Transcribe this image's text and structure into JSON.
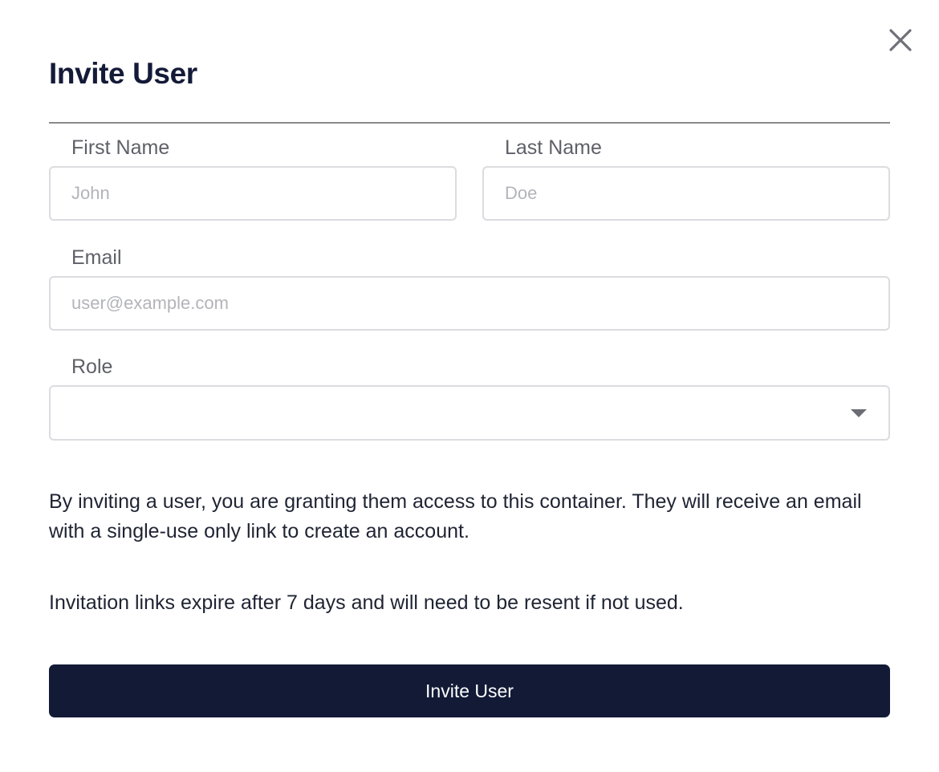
{
  "dialog": {
    "title": "Invite User",
    "close_icon": "close-icon"
  },
  "form": {
    "first_name": {
      "label": "First Name",
      "placeholder": "John",
      "value": ""
    },
    "last_name": {
      "label": "Last Name",
      "placeholder": "Doe",
      "value": ""
    },
    "email": {
      "label": "Email",
      "placeholder": "user@example.com",
      "value": ""
    },
    "role": {
      "label": "Role",
      "selected": "",
      "icon": "chevron-down-icon"
    }
  },
  "notices": [
    "By inviting a user, you are granting them access to this container. They will receive an email with a single-use only link to create an account.",
    "Invitation links expire after 7 days and will need to be resent if not used."
  ],
  "actions": {
    "submit_label": "Invite User"
  },
  "colors": {
    "primary": "#121a36",
    "title": "#141b38",
    "label": "#5f6068",
    "placeholder": "#b3b4ba",
    "border": "#dcdce0"
  }
}
